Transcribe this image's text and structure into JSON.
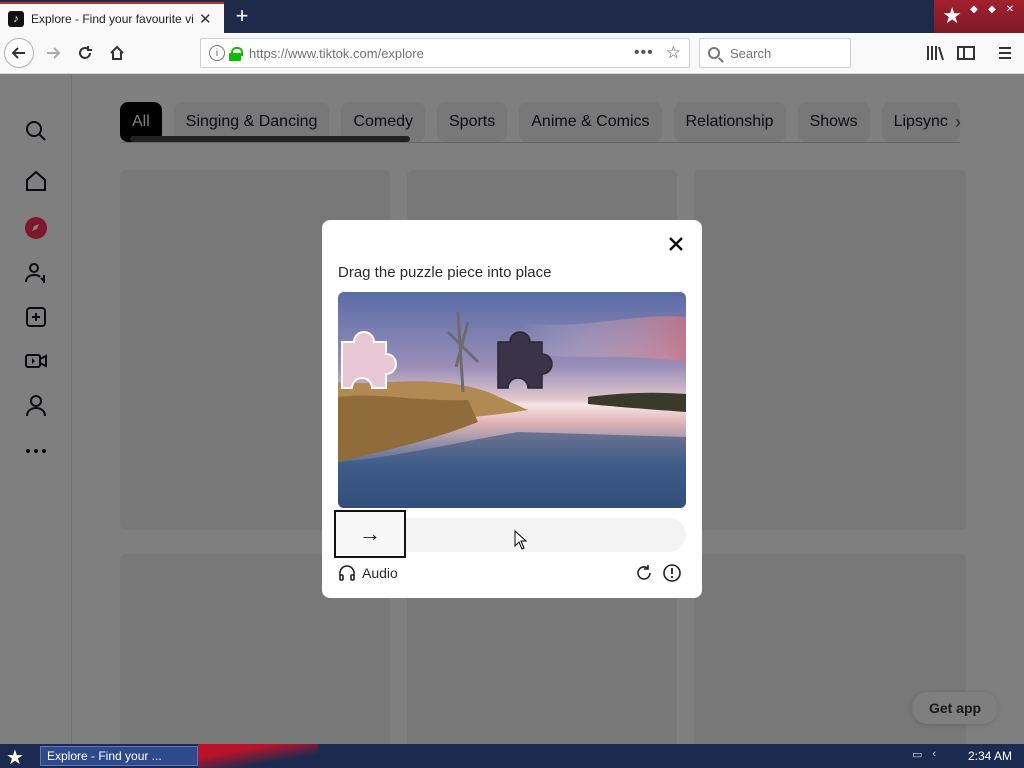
{
  "browser": {
    "tab_title": "Explore - Find your favourite videos on TikTok",
    "new_tab_symbol": "+",
    "url": "https://www.tiktok.com/explore",
    "search_placeholder": "Search"
  },
  "categories": [
    "All",
    "Singing & Dancing",
    "Comedy",
    "Sports",
    "Anime & Comics",
    "Relationship",
    "Shows",
    "Lipsync"
  ],
  "sidebar_icons": [
    "search-icon",
    "home-icon",
    "explore-compass-icon",
    "following-icon",
    "upload-icon",
    "live-icon",
    "profile-icon",
    "more-icon"
  ],
  "captcha": {
    "title": "Drag the puzzle piece into place",
    "slider_arrow": "→",
    "audio_label": "Audio",
    "close_symbol": "✕"
  },
  "get_app_label": "Get app",
  "taskbar": {
    "task_label": "Explore - Find your ...",
    "clock": "2:34 AM"
  },
  "colors": {
    "explore_accent": "#fe2c55",
    "secure_lock": "#12bc00",
    "taskbar_bg": "#1b2a4e"
  }
}
